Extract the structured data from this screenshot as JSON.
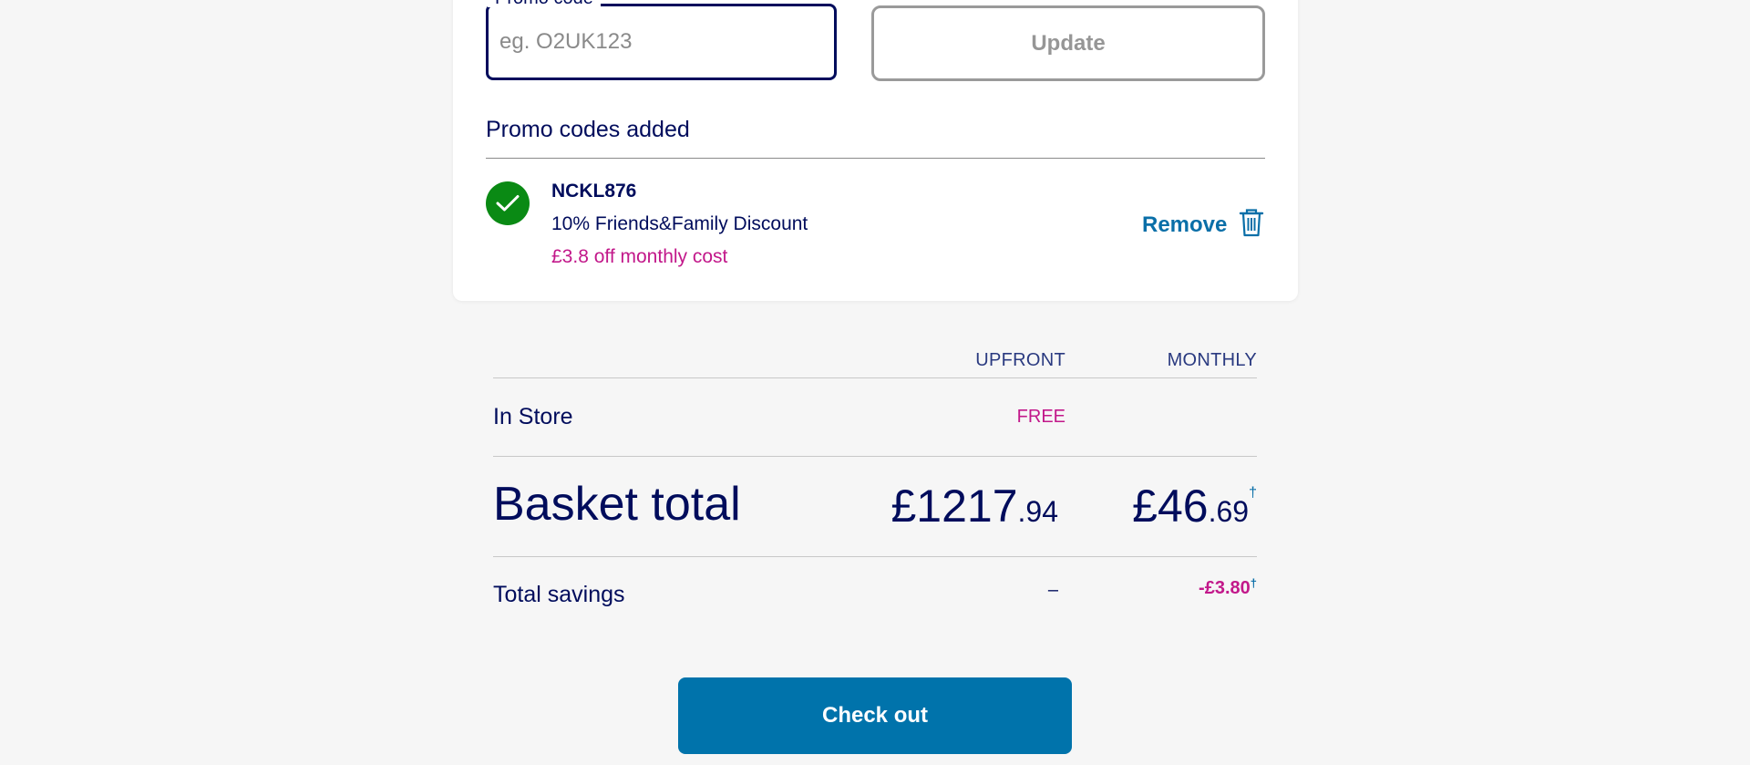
{
  "promo": {
    "field_label": "Promo code",
    "placeholder": "eg. O2UK123",
    "value": "",
    "update_label": "Update",
    "added_title": "Promo codes added",
    "applied": {
      "code": "NCKL876",
      "description": "10% Friends&Family Discount",
      "saving": "£3.8 off monthly cost",
      "remove_label": "Remove",
      "icon": "trash-icon",
      "status_icon": "check-icon"
    }
  },
  "totals": {
    "headers": {
      "upfront": "UPFRONT",
      "monthly": "MONTHLY"
    },
    "in_store": {
      "label": "In Store",
      "upfront": "FREE"
    },
    "basket": {
      "label": "Basket total",
      "upfront_main": "£1217",
      "upfront_decimals": ".94",
      "monthly_main": "£46",
      "monthly_decimals": ".69",
      "monthly_mark": "†"
    },
    "savings": {
      "label": "Total savings",
      "upfront": "–",
      "monthly": "-£3.80",
      "monthly_mark": "†"
    }
  },
  "checkout": {
    "label": "Check out"
  },
  "colors": {
    "brand_navy": "#000c5c",
    "accent_blue": "#0073ab",
    "discount_magenta": "#c2188a",
    "success_green": "#0a8a14"
  }
}
